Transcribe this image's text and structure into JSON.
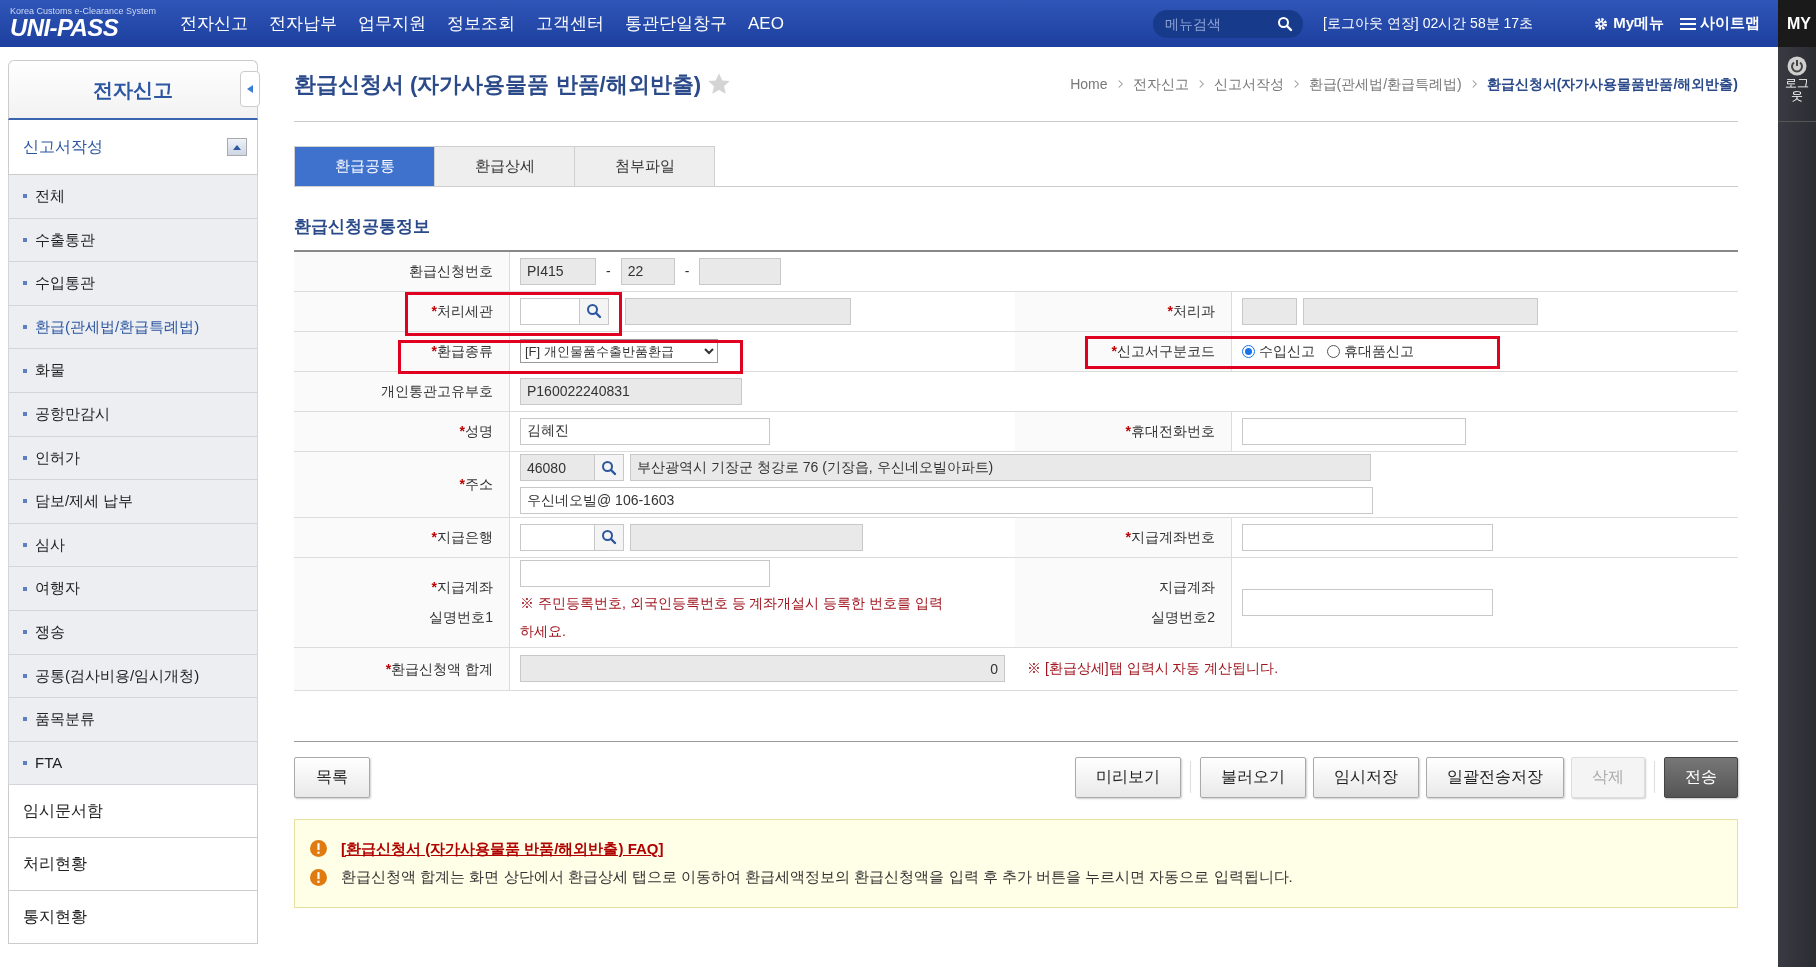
{
  "header": {
    "logo_subtitle": "Korea Customs e-Clearance System",
    "logo": "UNI-PASS",
    "nav": [
      "전자신고",
      "전자납부",
      "업무지원",
      "정보조회",
      "고객센터",
      "통관단일창구",
      "AEO"
    ],
    "search": {
      "placeholder": "메뉴검색"
    },
    "session": "[로그아웃 연장] 02시간 58분 17초",
    "my_menu": "My메뉴",
    "sitemap": "사이트맵",
    "side_tab": "MY"
  },
  "right_panel": {
    "logout_lines": [
      "로그",
      "웃"
    ]
  },
  "sidebar": {
    "title": "전자신고",
    "section": {
      "label": "신고서작성",
      "expanded": true,
      "items": [
        {
          "label": "전체",
          "selected": false
        },
        {
          "label": "수출통관",
          "selected": false
        },
        {
          "label": "수입통관",
          "selected": false
        },
        {
          "label": "환급(관세법/환급특례법)",
          "selected": true
        },
        {
          "label": "화물",
          "selected": false
        },
        {
          "label": "공항만감시",
          "selected": false
        },
        {
          "label": "인허가",
          "selected": false
        },
        {
          "label": "담보/제세 납부",
          "selected": false
        },
        {
          "label": "심사",
          "selected": false
        },
        {
          "label": "여행자",
          "selected": false
        },
        {
          "label": "쟁송",
          "selected": false
        },
        {
          "label": "공통(검사비용/임시개청)",
          "selected": false
        },
        {
          "label": "품목분류",
          "selected": false
        },
        {
          "label": "FTA",
          "selected": false
        }
      ]
    },
    "links": [
      "임시문서함",
      "처리현황",
      "통지현황"
    ]
  },
  "page": {
    "title": "환급신청서 (자가사용물품 반품/해외반출)",
    "favorite": false,
    "breadcrumb": [
      "Home",
      "전자신고",
      "신고서작성",
      "환급(관세법/환급특례법)",
      "환급신청서(자가사용물품반품/해외반출)"
    ]
  },
  "tabs": [
    {
      "label": "환급공통",
      "selected": true
    },
    {
      "label": "환급상세",
      "selected": false
    },
    {
      "label": "첨부파일",
      "selected": false
    }
  ],
  "section_title": "환급신청공통정보",
  "form": {
    "refund_no": {
      "label": "환급신청번호",
      "prefix": "PI415",
      "year": "22",
      "separators": [
        "-",
        "-"
      ]
    },
    "customs_office": {
      "label": "*처리세관",
      "required": true,
      "highlighted": true
    },
    "department": {
      "label": "*처리과",
      "required": true
    },
    "refund_type": {
      "label": "*환급종류",
      "required": true,
      "highlighted": true,
      "value": "[F] 개인물품수출반품환급"
    },
    "declaration_code": {
      "label": "*신고서구분코드",
      "required": true,
      "highlighted": true,
      "options": [
        {
          "label": "수입신고",
          "selected": true
        },
        {
          "label": "휴대품신고",
          "selected": false
        }
      ]
    },
    "personal_code": {
      "label": "개인통관고유부호",
      "value": "P160022240831"
    },
    "name": {
      "label": "*성명",
      "required": true,
      "value": "김혜진"
    },
    "phone": {
      "label": "*휴대전화번호",
      "required": true
    },
    "address": {
      "label": "*주소",
      "required": true,
      "zip": "46080",
      "line1": "부산광역시 기장군 청강로 76 (기장읍, 우신네오빌아파트)",
      "line2": "우신네오빌@ 106-1603"
    },
    "bank": {
      "label": "*지급은행",
      "required": true
    },
    "account_no": {
      "label": "*지급계좌번호",
      "required": true
    },
    "account_id1": {
      "label_lines": [
        "*지급계좌",
        "실명번호1"
      ],
      "required": true,
      "note": "※ 주민등록번호, 외국인등록번호 등 계좌개설시 등록한 번호를 입력하세요."
    },
    "account_id2": {
      "label_lines": [
        "지급계좌",
        "실명번호2"
      ],
      "required": false
    },
    "total": {
      "label": "*환급신청액 합계",
      "required": true,
      "value": "0",
      "note": "※ [환급상세]탭 입력시 자동 계산됩니다."
    }
  },
  "buttons_left": [
    {
      "label": "목록",
      "kind": "default",
      "disabled": false
    }
  ],
  "buttons_right": [
    {
      "label": "미리보기",
      "kind": "default",
      "disabled": false
    },
    {
      "label": "불러오기",
      "kind": "default",
      "disabled": false
    },
    {
      "label": "임시저장",
      "kind": "default",
      "disabled": false
    },
    {
      "label": "일괄전송저장",
      "kind": "default",
      "disabled": false
    },
    {
      "label": "삭제",
      "kind": "default",
      "disabled": true
    },
    {
      "label": "전송",
      "kind": "primary",
      "disabled": false
    }
  ],
  "notices": [
    {
      "kind": "link",
      "text": "[환급신청서 (자가사용물품 반품/해외반출) FAQ]"
    },
    {
      "kind": "text",
      "text": "환급신청액 합계는 화면 상단에서 환급상세 탭으로 이동하여 환급세액정보의 환급신청액을 입력 후 추가 버튼을 누르시면 자동으로 입력됩니다."
    }
  ]
}
